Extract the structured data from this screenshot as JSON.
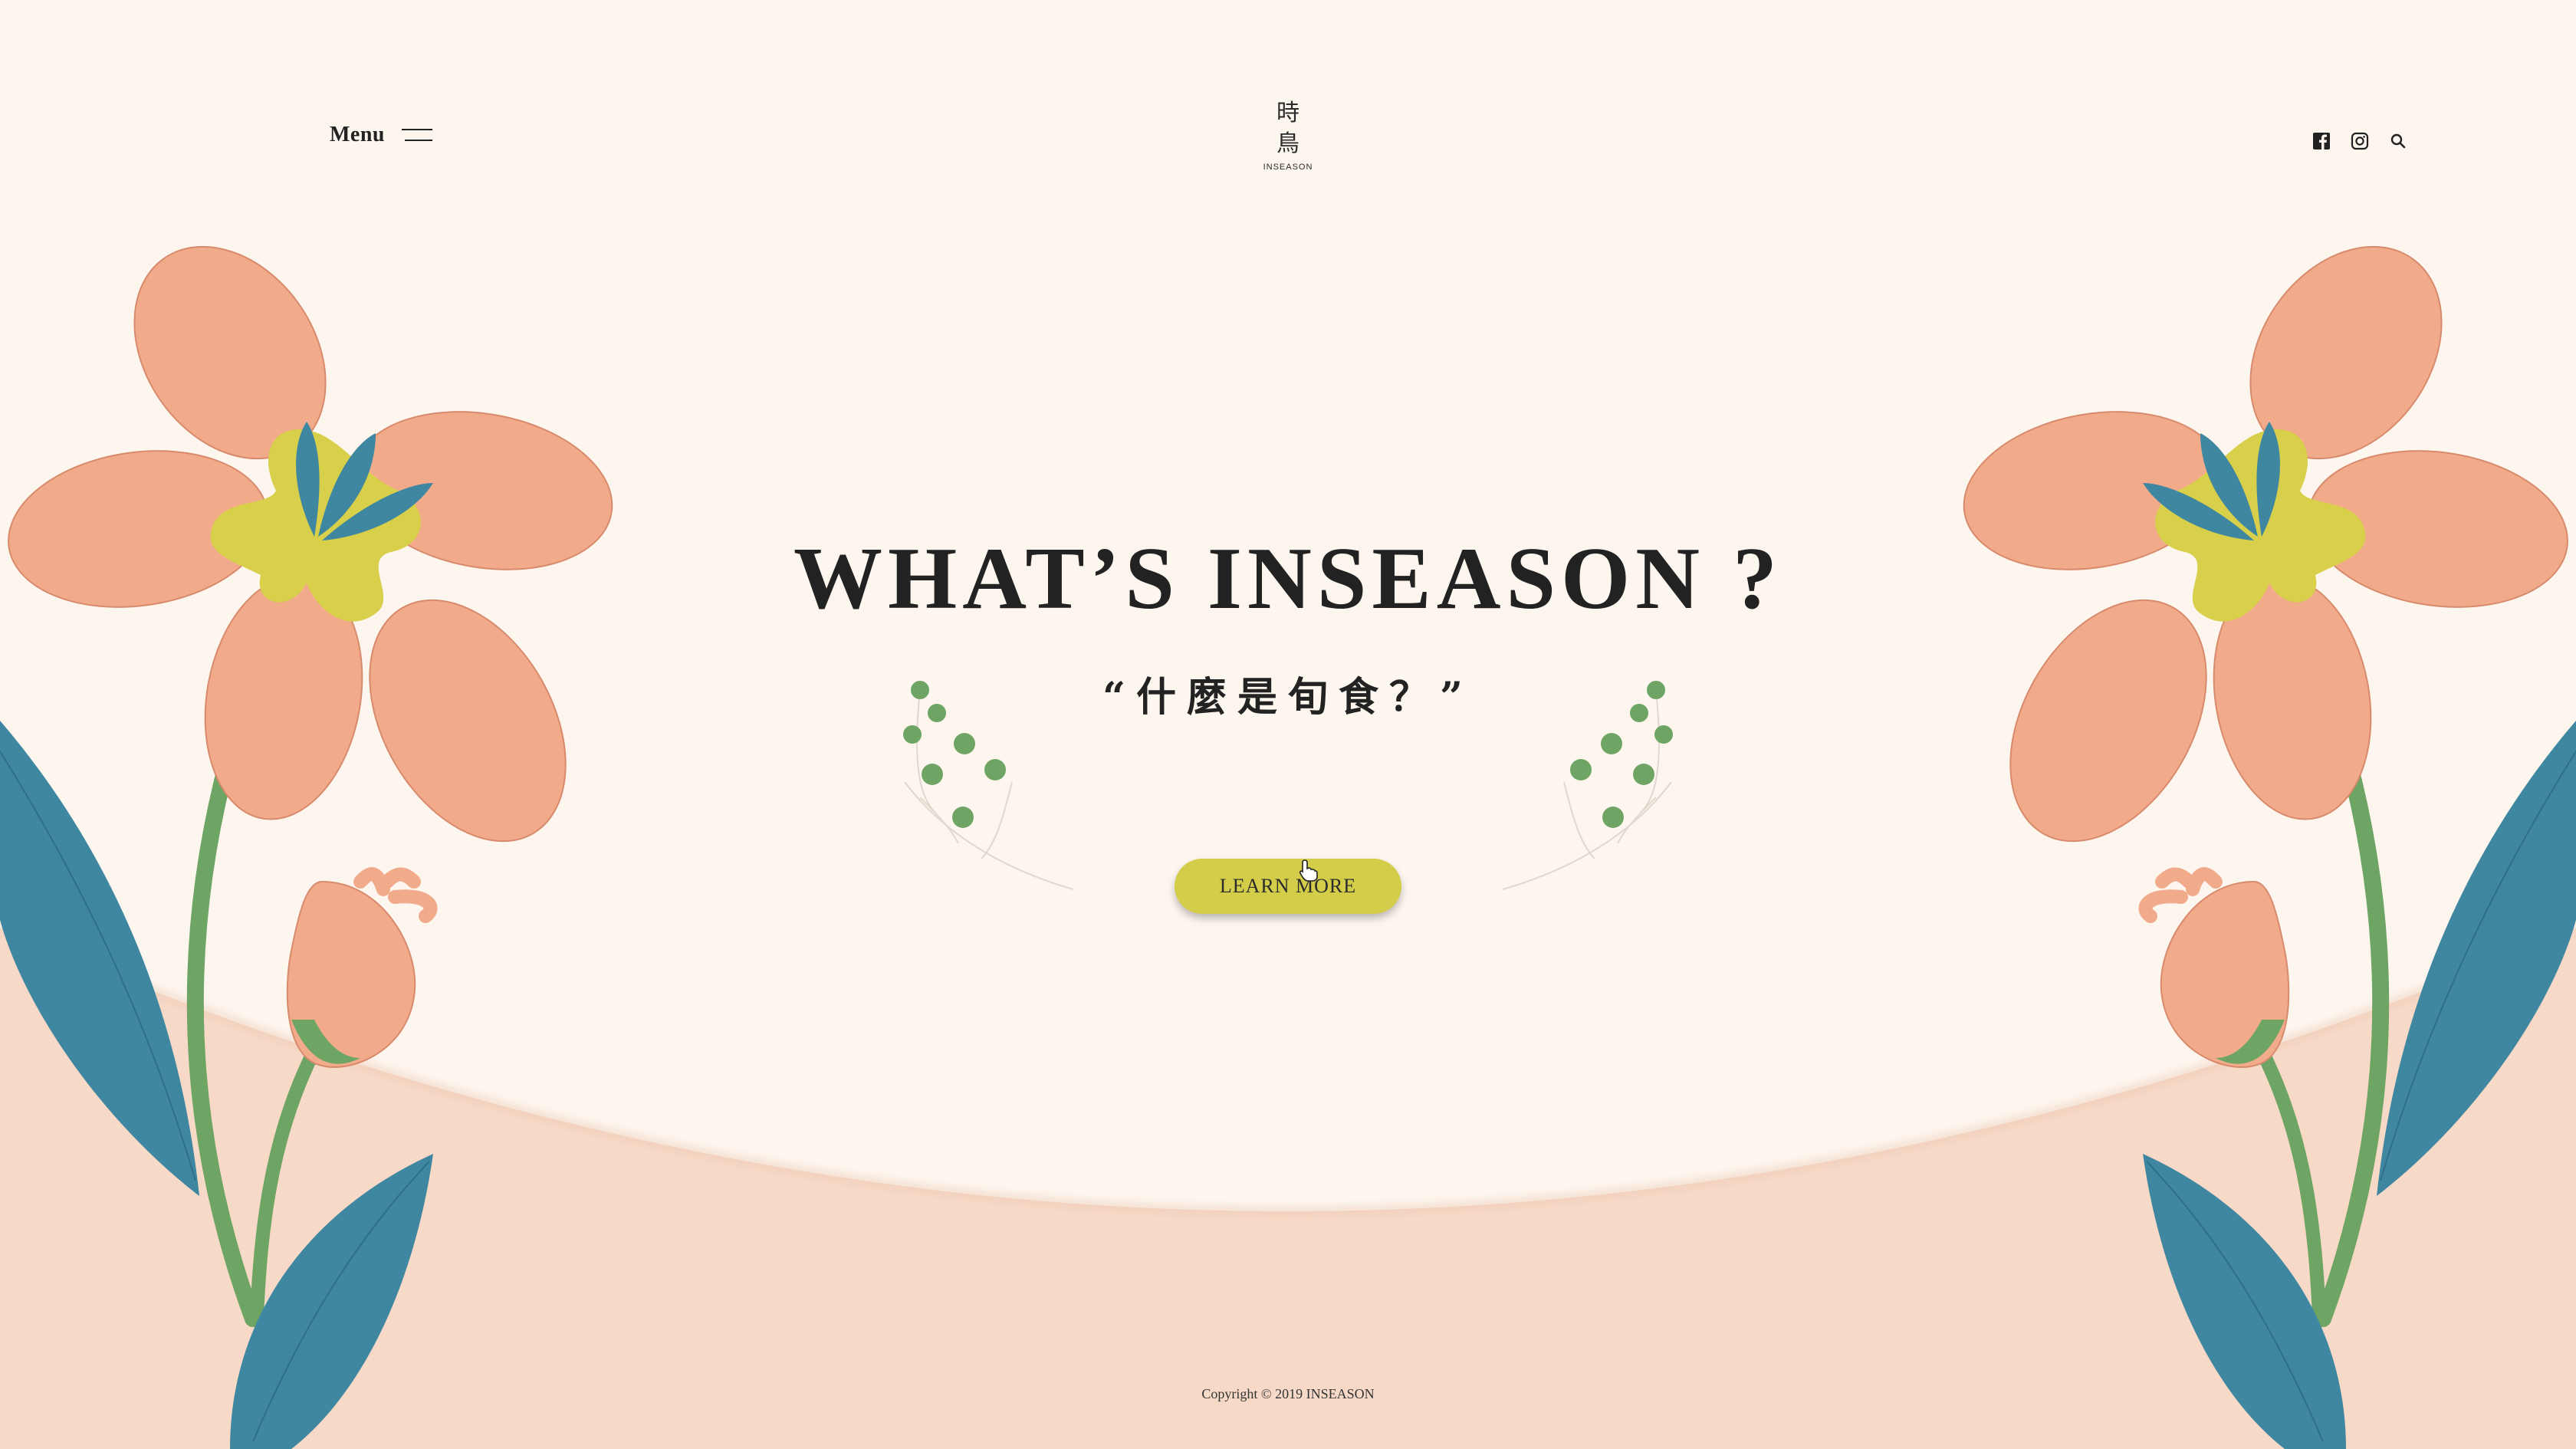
{
  "header": {
    "menu_label": "Menu",
    "logo": {
      "char_top": "時",
      "char_bottom": "鳥",
      "wordmark": "INSEASON"
    },
    "social_icons": [
      "facebook-icon",
      "instagram-icon",
      "search-icon"
    ]
  },
  "hero": {
    "title": "WHAT’S INSEASON ?",
    "subtitle": "“什麼是旬食？”",
    "cta_label": "LEARN MORE"
  },
  "footer": {
    "copyright": "Copyright © 2019 INSEASON"
  },
  "colors": {
    "background": "#fdf6ef",
    "bottom_band": "#f7d9c7",
    "petal": "#f2ab8a",
    "petal_vein": "#d88a6c",
    "leaf": "#3f87a0",
    "stem": "#6fa564",
    "flower_center": "#d8cf4a",
    "button": "#d4cd4a",
    "text": "#222222"
  }
}
